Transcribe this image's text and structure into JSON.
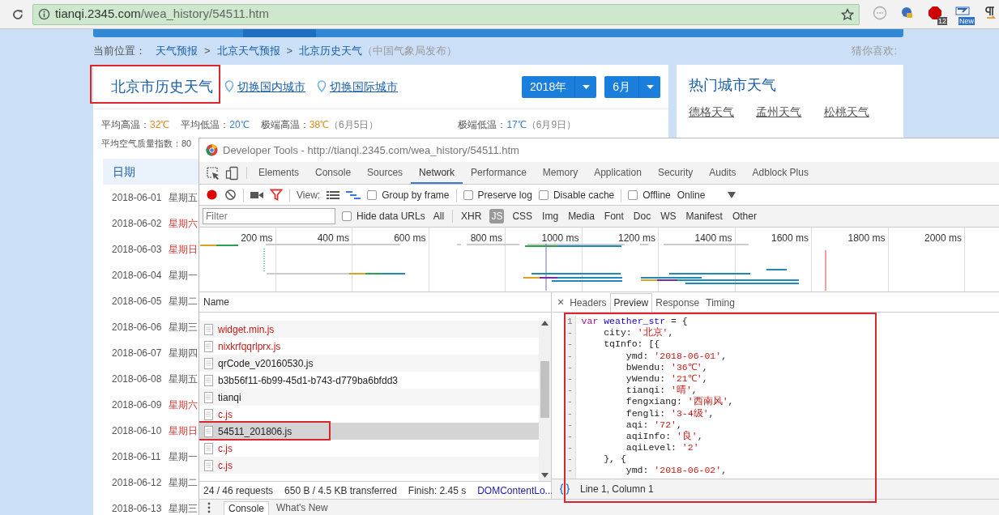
{
  "browser": {
    "url_host": "tianqi.2345.com",
    "url_path": "/wea_history/54511.htm",
    "extensions": [
      {
        "kind": "plain"
      },
      {
        "kind": "plain"
      },
      {
        "kind": "badge",
        "badge": "12"
      },
      {
        "kind": "badge",
        "badge": "New"
      },
      {
        "kind": "plain"
      }
    ]
  },
  "page": {
    "breadcrumb": {
      "label": "当前位置：",
      "separator": ">",
      "links": [
        "天气预报",
        "北京天气预报",
        "北京历史天气"
      ],
      "note": "（中国气象局发布）"
    },
    "guess_label": "猜你喜欢:",
    "title": "北京市历史天气",
    "switch_links": [
      "切换国内城市",
      "切换国际城市"
    ],
    "selects": [
      "2018年",
      "6月"
    ],
    "stats": [
      {
        "label": "平均高温：",
        "value": "32℃",
        "kind": "high"
      },
      {
        "label": "平均低温：",
        "value": "20℃",
        "kind": "low"
      },
      {
        "label": "极端高温：",
        "value": "38℃",
        "kind": "high",
        "note": "（6月5日）"
      },
      {
        "label": "极端低温：",
        "value": "17℃",
        "kind": "low",
        "note": "（6月9日）"
      }
    ],
    "aqi_stat": {
      "label": "平均空气质量指数：",
      "value": "80"
    },
    "table": {
      "header": "日期",
      "rows": [
        {
          "date": "2018-06-01",
          "weekday": "星期五",
          "weekend": false
        },
        {
          "date": "2018-06-02",
          "weekday": "星期六",
          "weekend": true
        },
        {
          "date": "2018-06-03",
          "weekday": "星期日",
          "weekend": true
        },
        {
          "date": "2018-06-04",
          "weekday": "星期一",
          "weekend": false
        },
        {
          "date": "2018-06-05",
          "weekday": "星期二",
          "weekend": false
        },
        {
          "date": "2018-06-06",
          "weekday": "星期三",
          "weekend": false
        },
        {
          "date": "2018-06-07",
          "weekday": "星期四",
          "weekend": false
        },
        {
          "date": "2018-06-08",
          "weekday": "星期五",
          "weekend": false
        },
        {
          "date": "2018-06-09",
          "weekday": "星期六",
          "weekend": true
        },
        {
          "date": "2018-06-10",
          "weekday": "星期日",
          "weekend": true
        },
        {
          "date": "2018-06-11",
          "weekday": "星期一",
          "weekend": false
        },
        {
          "date": "2018-06-12",
          "weekday": "星期二",
          "weekend": false
        },
        {
          "date": "2018-06-13",
          "weekday": "星期三",
          "weekend": false
        }
      ]
    },
    "hot_cities": {
      "title": "热门城市天气",
      "links": [
        "德格天气",
        "孟州天气",
        "松桃天气"
      ]
    }
  },
  "devtools": {
    "title": "Developer Tools - http://tianqi.2345.com/wea_history/54511.htm",
    "tabs": [
      {
        "label": "Elements",
        "selected": false
      },
      {
        "label": "Console",
        "selected": false
      },
      {
        "label": "Sources",
        "selected": false
      },
      {
        "label": "Network",
        "selected": true
      },
      {
        "label": "Performance",
        "selected": false
      },
      {
        "label": "Memory",
        "selected": false
      },
      {
        "label": "Application",
        "selected": false
      },
      {
        "label": "Security",
        "selected": false
      },
      {
        "label": "Audits",
        "selected": false
      },
      {
        "label": "Adblock Plus",
        "selected": false
      }
    ],
    "recording": true,
    "filter_active": true,
    "view_label": "View:",
    "options": [
      {
        "label": "Group by frame",
        "checked": false
      },
      {
        "label": "Preserve log",
        "checked": false
      },
      {
        "label": "Disable cache",
        "checked": false
      },
      {
        "label": "Offline",
        "checked": false
      }
    ],
    "throttle": "Online",
    "filter": {
      "placeholder": "Filter",
      "hide_data_urls": {
        "label": "Hide data URLs",
        "checked": false
      },
      "types": [
        {
          "label": "All",
          "selected": false
        },
        {
          "label": "XHR",
          "selected": false
        },
        {
          "label": "JS",
          "selected": true
        },
        {
          "label": "CSS",
          "selected": false
        },
        {
          "label": "Img",
          "selected": false
        },
        {
          "label": "Media",
          "selected": false
        },
        {
          "label": "Font",
          "selected": false
        },
        {
          "label": "Doc",
          "selected": false
        },
        {
          "label": "WS",
          "selected": false
        },
        {
          "label": "Manifest",
          "selected": false
        },
        {
          "label": "Other",
          "selected": false
        }
      ]
    },
    "timeline_ticks": [
      "200 ms",
      "400 ms",
      "600 ms",
      "800 ms",
      "1000 ms",
      "1200 ms",
      "1400 ms",
      "1600 ms",
      "1800 ms",
      "2000 ms"
    ],
    "requests_header": "Name",
    "requests": [
      {
        "name": "widget.min.js",
        "error": true,
        "selected": false,
        "annotated": false
      },
      {
        "name": "nixkrfqqrlprx.js",
        "error": true,
        "selected": false,
        "annotated": false
      },
      {
        "name": "qrCode_v20160530.js",
        "error": false,
        "selected": false,
        "annotated": false
      },
      {
        "name": "b3b56f11-6b99-45d1-b743-d779ba6bfdd3",
        "error": false,
        "selected": false,
        "annotated": false
      },
      {
        "name": "tianqi",
        "error": false,
        "selected": false,
        "annotated": false
      },
      {
        "name": "c.js",
        "error": true,
        "selected": false,
        "annotated": false
      },
      {
        "name": "54511_201806.js",
        "error": false,
        "selected": true,
        "annotated": true
      },
      {
        "name": "c.js",
        "error": true,
        "selected": false,
        "annotated": false
      },
      {
        "name": "c.js",
        "error": true,
        "selected": false,
        "annotated": false
      }
    ],
    "summary": [
      "24 / 46 requests",
      "650 B / 4.5 KB transferred",
      "Finish: 2.45 s"
    ],
    "summary_link": "DOMContentLo...",
    "detail_close": "×",
    "detail_tabs": [
      {
        "label": "Headers",
        "selected": false
      },
      {
        "label": "Preview",
        "selected": true
      },
      {
        "label": "Response",
        "selected": false
      },
      {
        "label": "Timing",
        "selected": false
      }
    ],
    "code": [
      {
        "gutter": "1",
        "tokens": [
          {
            "kind": "keyword",
            "text": "var "
          },
          {
            "kind": "def",
            "text": "weather_str"
          },
          {
            "kind": "plain",
            "text": " = {"
          }
        ]
      },
      {
        "gutter": "-",
        "tokens": [
          {
            "kind": "plain",
            "text": "    city: "
          },
          {
            "kind": "string",
            "text": "'北京'"
          },
          {
            "kind": "plain",
            "text": ","
          }
        ]
      },
      {
        "gutter": "-",
        "tokens": [
          {
            "kind": "plain",
            "text": "    tqInfo: [{"
          }
        ]
      },
      {
        "gutter": "-",
        "tokens": [
          {
            "kind": "plain",
            "text": "        ymd: "
          },
          {
            "kind": "string",
            "text": "'2018-06-01'"
          },
          {
            "kind": "plain",
            "text": ","
          }
        ]
      },
      {
        "gutter": "-",
        "tokens": [
          {
            "kind": "plain",
            "text": "        bWendu: "
          },
          {
            "kind": "string",
            "text": "'36℃'"
          },
          {
            "kind": "plain",
            "text": ","
          }
        ]
      },
      {
        "gutter": "-",
        "tokens": [
          {
            "kind": "plain",
            "text": "        yWendu: "
          },
          {
            "kind": "string",
            "text": "'21℃'"
          },
          {
            "kind": "plain",
            "text": ","
          }
        ]
      },
      {
        "gutter": "-",
        "tokens": [
          {
            "kind": "plain",
            "text": "        tianqi: "
          },
          {
            "kind": "string",
            "text": "'晴'"
          },
          {
            "kind": "plain",
            "text": ","
          }
        ]
      },
      {
        "gutter": "-",
        "tokens": [
          {
            "kind": "plain",
            "text": "        fengxiang: "
          },
          {
            "kind": "string",
            "text": "'西南风'"
          },
          {
            "kind": "plain",
            "text": ","
          }
        ]
      },
      {
        "gutter": "-",
        "tokens": [
          {
            "kind": "plain",
            "text": "        fengli: "
          },
          {
            "kind": "string",
            "text": "'3-4级'"
          },
          {
            "kind": "plain",
            "text": ","
          }
        ]
      },
      {
        "gutter": "-",
        "tokens": [
          {
            "kind": "plain",
            "text": "        aqi: "
          },
          {
            "kind": "string",
            "text": "'72'"
          },
          {
            "kind": "plain",
            "text": ","
          }
        ]
      },
      {
        "gutter": "-",
        "tokens": [
          {
            "kind": "plain",
            "text": "        aqiInfo: "
          },
          {
            "kind": "string",
            "text": "'良'"
          },
          {
            "kind": "plain",
            "text": ","
          }
        ]
      },
      {
        "gutter": "-",
        "tokens": [
          {
            "kind": "plain",
            "text": "        aqiLevel: "
          },
          {
            "kind": "string",
            "text": "'2'"
          }
        ]
      },
      {
        "gutter": "-",
        "tokens": [
          {
            "kind": "plain",
            "text": "    }, {"
          }
        ]
      },
      {
        "gutter": "-",
        "tokens": [
          {
            "kind": "plain",
            "text": "        ymd: "
          },
          {
            "kind": "string",
            "text": "'2018-06-02'"
          },
          {
            "kind": "plain",
            "text": ","
          }
        ]
      }
    ],
    "cursor": "Line 1, Column 1",
    "drawer_tabs": [
      {
        "label": "Console",
        "selected": true
      },
      {
        "label": "What's New",
        "selected": false
      }
    ]
  }
}
